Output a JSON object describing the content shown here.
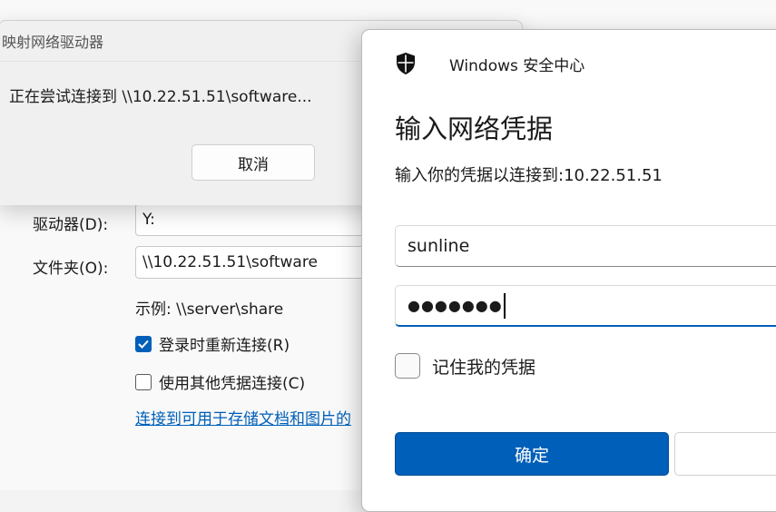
{
  "map_drive": {
    "drive_label": "驱动器(D):",
    "drive_value": "Y:",
    "folder_label": "文件夹(O):",
    "folder_value": "\\\\10.22.51.51\\software",
    "example_text": "示例: \\\\server\\share",
    "reconnect_label": "登录时重新连接(R)",
    "reconnect_checked": true,
    "other_creds_label": "使用其他凭据连接(C)",
    "other_creds_checked": false,
    "link_text": "连接到可用于存储文档和图片的"
  },
  "progress_dialog": {
    "title": "映射网络驱动器",
    "message": "正在尝试连接到 \\\\10.22.51.51\\software...",
    "cancel_label": "取消"
  },
  "security_dialog": {
    "app_title": "Windows 安全中心",
    "heading": "输入网络凭据",
    "subtitle": "输入你的凭据以连接到:10.22.51.51",
    "username_value": "sunline",
    "password_mask": "●●●●●●●",
    "remember_label": "记住我的凭据",
    "remember_checked": false,
    "ok_label": "确定",
    "accent_color": "#005fb8",
    "shield_icon": "shield-icon"
  }
}
